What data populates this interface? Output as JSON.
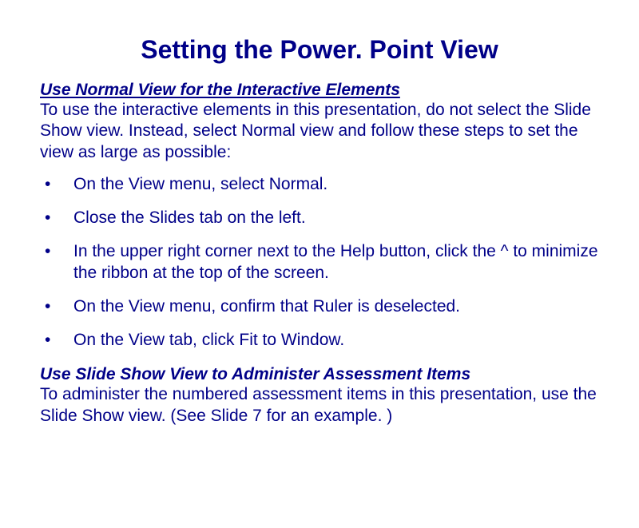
{
  "title": "Setting the Power. Point View",
  "section1": {
    "heading": "Use Normal View for the Interactive Elements",
    "body": "To use the interactive elements in this presentation, do not select the Slide Show view. Instead, select Normal view and follow these steps to set the view as large as possible:",
    "bullets": [
      "On the View menu, select Normal.",
      "Close the Slides tab on the left.",
      "In the upper right corner next to the Help button, click the ^ to minimize the ribbon at the top of the screen.",
      "On the View menu, confirm that Ruler is deselected.",
      "On the View tab, click Fit to Window."
    ]
  },
  "section2": {
    "heading": "Use Slide Show View to Administer Assessment Items",
    "body": "To administer the numbered assessment items in this presentation, use the Slide Show view. (See Slide 7 for an example. )"
  }
}
